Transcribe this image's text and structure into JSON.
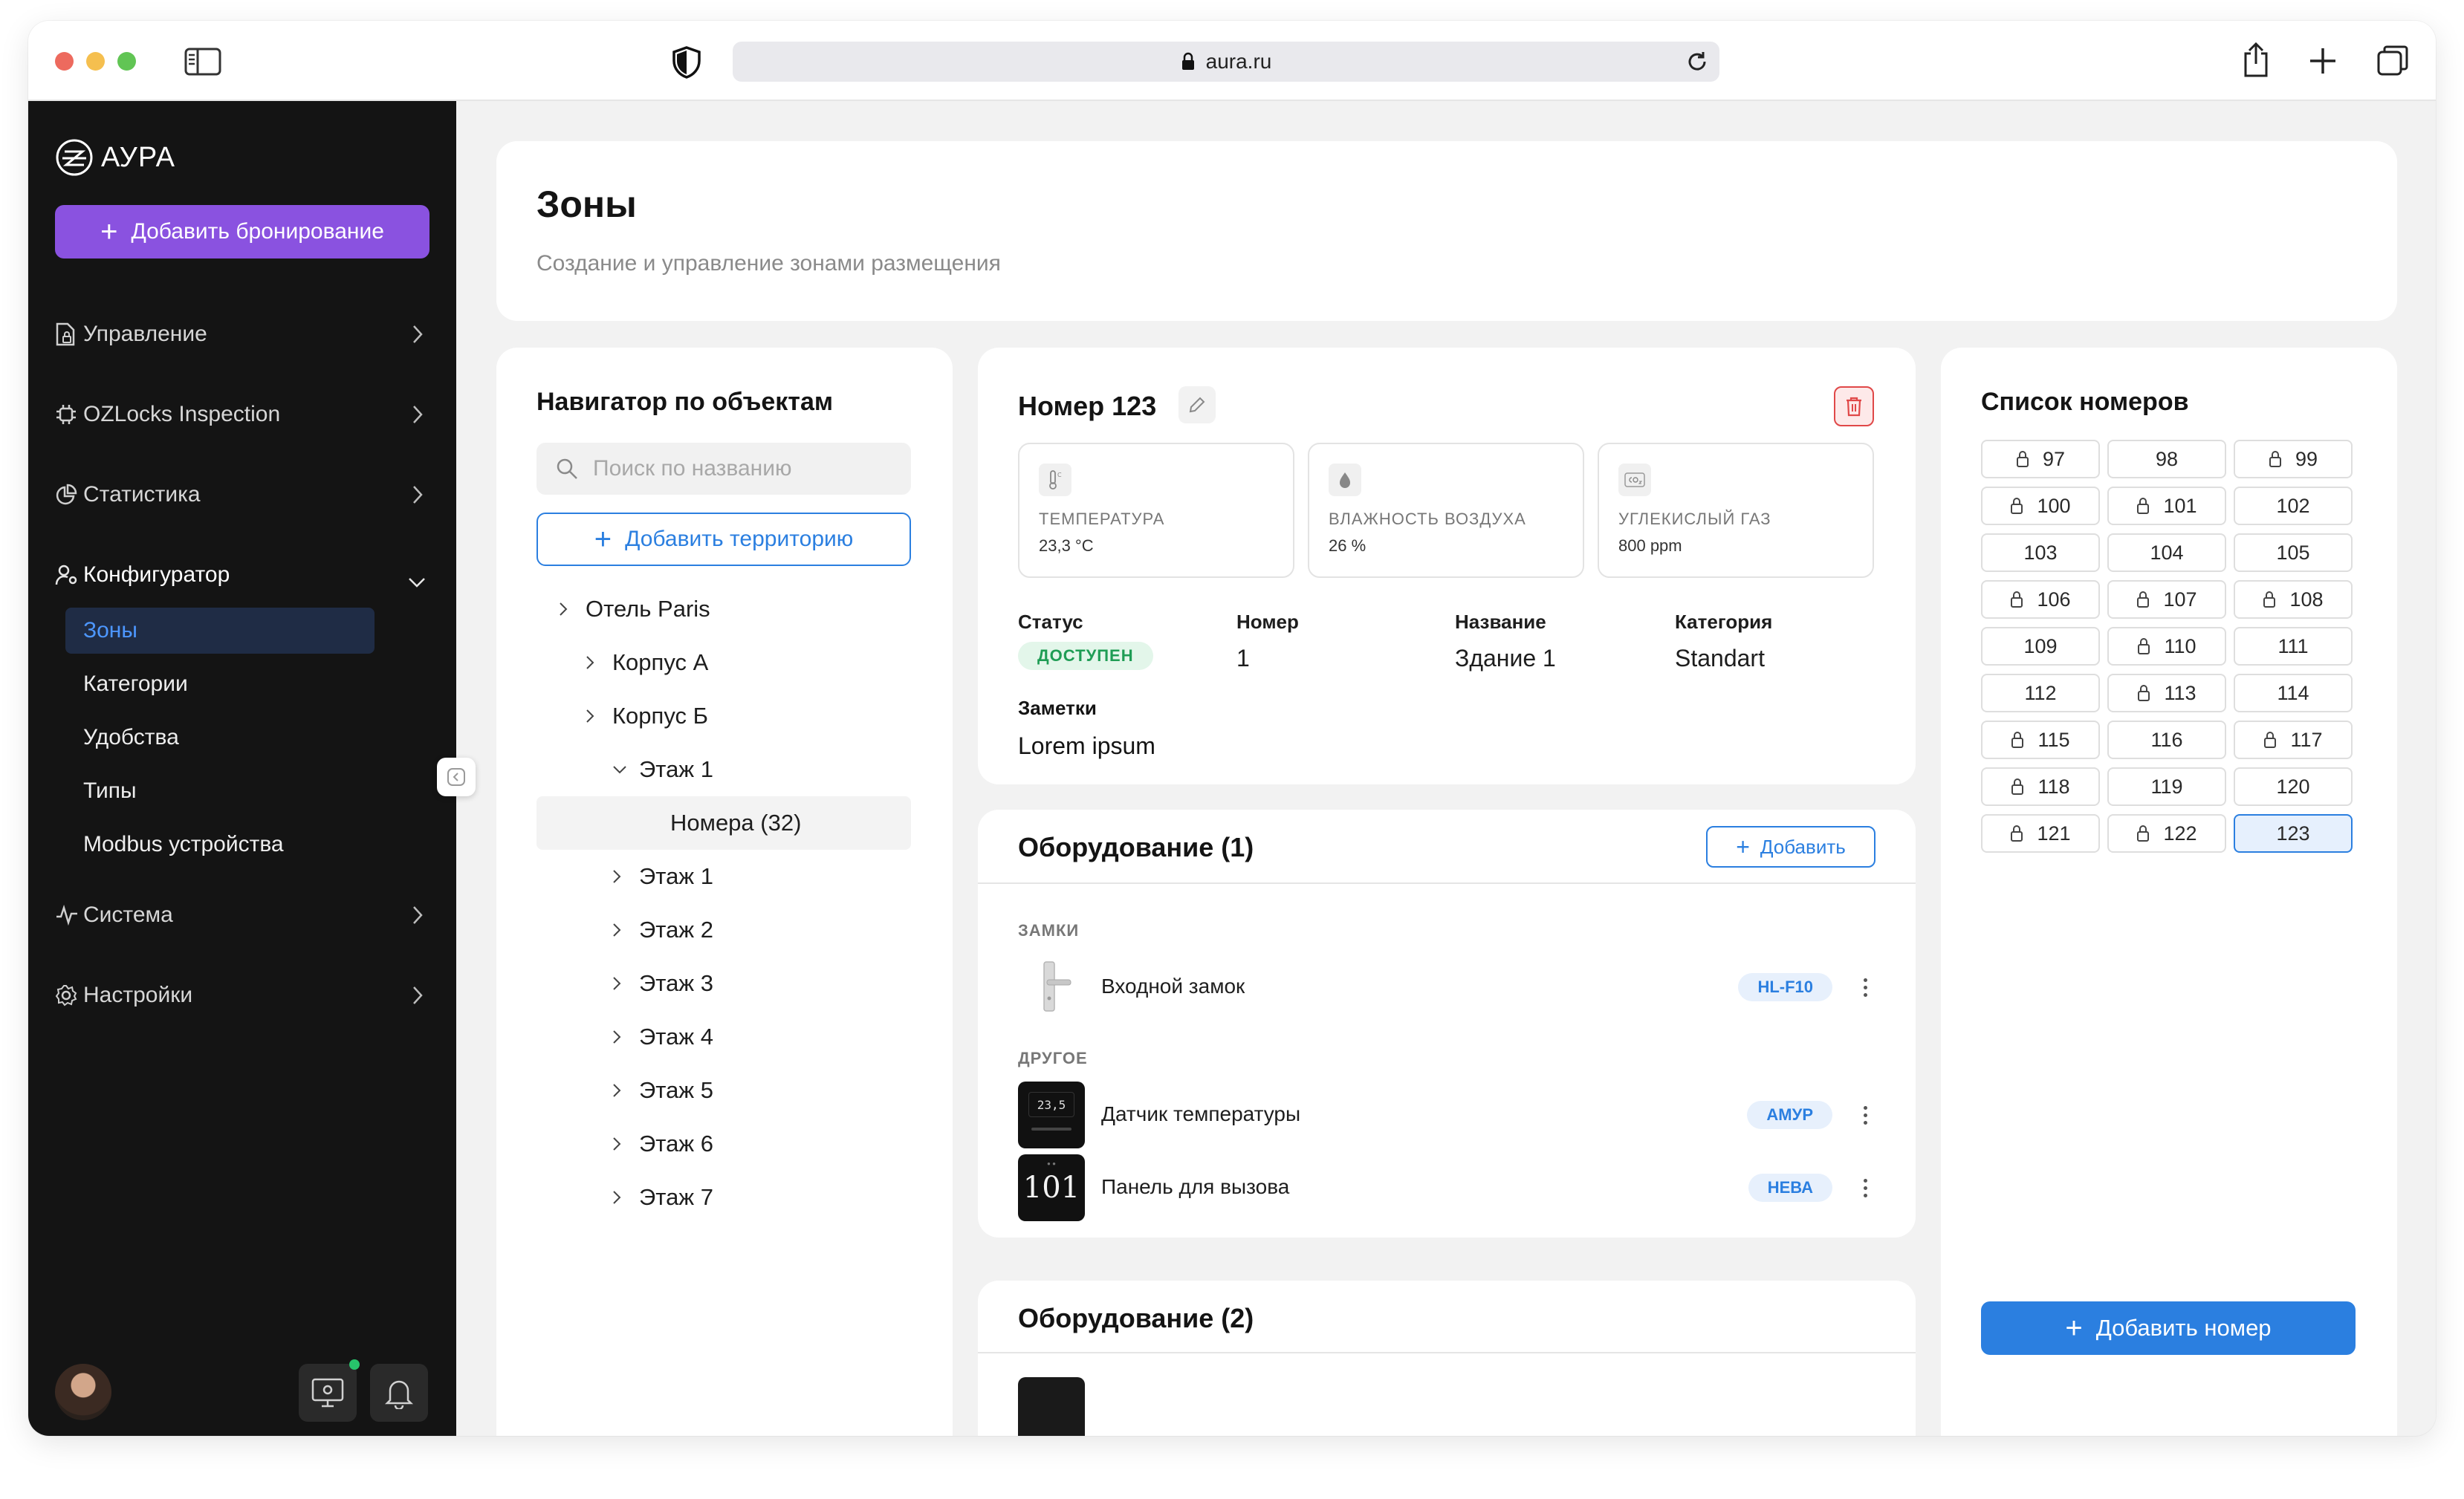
{
  "browser": {
    "url": "aura.ru"
  },
  "sidebar": {
    "brand": "АУРА",
    "add_booking": "Добавить бронирование",
    "items": [
      {
        "label": "Управление",
        "icon": "document-lock-icon"
      },
      {
        "label": "OZLocks Inspection",
        "icon": "chip-icon"
      },
      {
        "label": "Статистика",
        "icon": "pie-chart-icon"
      },
      {
        "label": "Конфигуратор",
        "icon": "user-gear-icon"
      },
      {
        "label": "Система",
        "icon": "pulse-icon"
      },
      {
        "label": "Настройки",
        "icon": "gear-icon"
      }
    ],
    "sub_items": [
      "Зоны",
      "Категории",
      "Удобства",
      "Типы",
      "Modbus устройства"
    ]
  },
  "header": {
    "title": "Зоны",
    "subtitle": "Создание и управление зонами размещения"
  },
  "navigator": {
    "title": "Навигатор по объектам",
    "search_placeholder": "Поиск по названию",
    "add_territory": "Добавить территорию",
    "tree": [
      "Отель Paris",
      "Корпус А",
      "Корпус Б",
      "Этаж 1",
      "Номера (32)",
      "Этаж 1",
      "Этаж 2",
      "Этаж 3",
      "Этаж 4",
      "Этаж 5",
      "Этаж 6",
      "Этаж 7"
    ]
  },
  "room": {
    "title": "Номер 123",
    "sensors": [
      {
        "label": "ТЕМПЕРАТУРА",
        "value": "23,3 °C",
        "icon": "thermometer-icon"
      },
      {
        "label": "ВЛАЖНОСТЬ ВОЗДУХА",
        "value": "26 %",
        "icon": "drop-icon"
      },
      {
        "label": "УГЛЕКИСЛЫЙ ГАЗ",
        "value": "800 ppm",
        "icon": "co2-icon"
      }
    ],
    "props": {
      "status_label": "Статус",
      "status_value": "ДОСТУПЕН",
      "number_label": "Номер",
      "number_value": "1",
      "name_label": "Название",
      "name_value": "Здание 1",
      "category_label": "Категория",
      "category_value": "Standart"
    },
    "notes_label": "Заметки",
    "notes_value": "Lorem ipsum"
  },
  "equipment1": {
    "title": "Оборудование (1)",
    "add_label": "Добавить",
    "sections": [
      {
        "title": "ЗАМКИ"
      },
      {
        "title": "ДРУГОЕ"
      }
    ],
    "items": [
      {
        "name": "Входной замок",
        "badge": "HL-F10"
      },
      {
        "name": "Датчик температуры",
        "badge": "АМУР",
        "display": "23,5"
      },
      {
        "name": "Панель для вызова",
        "badge": "НЕВА",
        "display": "101"
      }
    ]
  },
  "equipment2": {
    "title": "Оборудование (2)"
  },
  "rooms": {
    "title": "Список номеров",
    "list": [
      {
        "n": "97",
        "locked": true
      },
      {
        "n": "98",
        "locked": false
      },
      {
        "n": "99",
        "locked": true
      },
      {
        "n": "100",
        "locked": true
      },
      {
        "n": "101",
        "locked": true
      },
      {
        "n": "102",
        "locked": false
      },
      {
        "n": "103",
        "locked": false
      },
      {
        "n": "104",
        "locked": false
      },
      {
        "n": "105",
        "locked": false
      },
      {
        "n": "106",
        "locked": true
      },
      {
        "n": "107",
        "locked": true
      },
      {
        "n": "108",
        "locked": true
      },
      {
        "n": "109",
        "locked": false
      },
      {
        "n": "110",
        "locked": true
      },
      {
        "n": "111",
        "locked": false
      },
      {
        "n": "112",
        "locked": false
      },
      {
        "n": "113",
        "locked": true
      },
      {
        "n": "114",
        "locked": false
      },
      {
        "n": "115",
        "locked": true
      },
      {
        "n": "116",
        "locked": false
      },
      {
        "n": "117",
        "locked": true
      },
      {
        "n": "118",
        "locked": true
      },
      {
        "n": "119",
        "locked": false
      },
      {
        "n": "120",
        "locked": false
      },
      {
        "n": "121",
        "locked": true
      },
      {
        "n": "122",
        "locked": true
      },
      {
        "n": "123",
        "locked": false,
        "selected": true
      }
    ],
    "add_label": "Добавить номер"
  },
  "colors": {
    "accent": "#2b7fe0",
    "brand": "#8a52e0",
    "sidebar_bg": "#141414",
    "status_green": "#1f9d55",
    "danger": "#e04848"
  }
}
